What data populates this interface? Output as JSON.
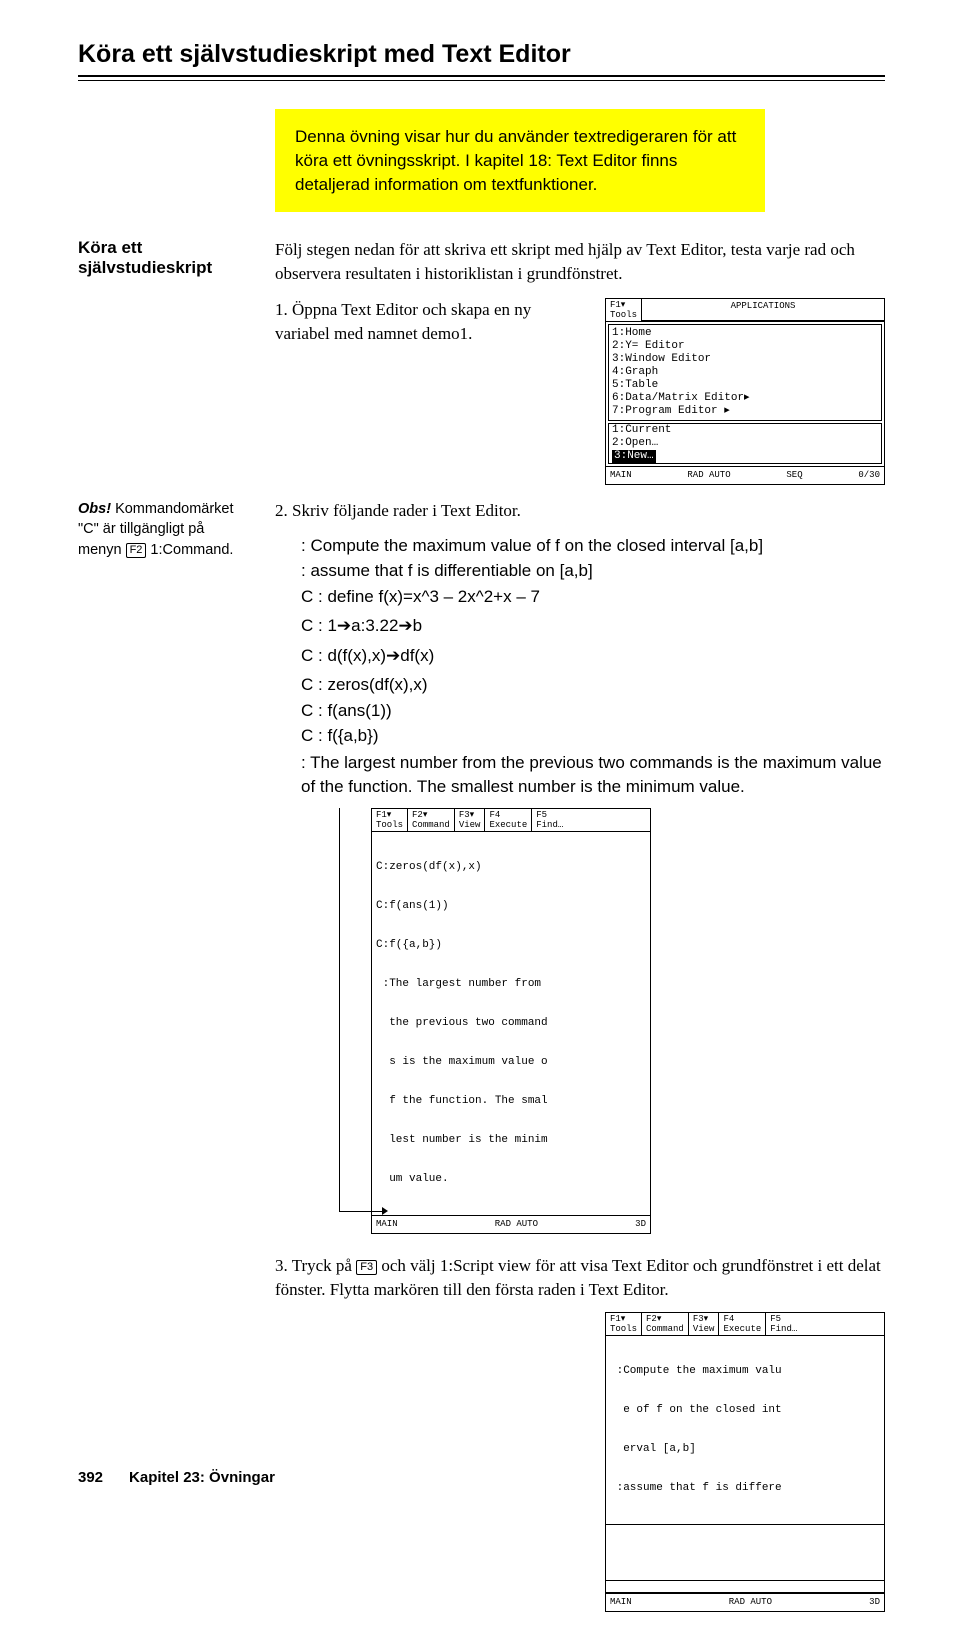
{
  "section_title": "Köra ett självstudieskript med Text Editor",
  "intro": "Denna övning visar hur du använder textredigeraren för att köra ett övningsskript. I kapitel 18: Text Editor finns detaljerad information om textfunktioner.",
  "col1": {
    "hd1": "Köra ett självstudieskript",
    "note_strong": "Obs! ",
    "note": "Kommandomärket \"C\" är tillgängligt på menyn ",
    "note_key": "F2",
    "note_tail": " 1:Command."
  },
  "body": {
    "p1": "Följ stegen nedan för att skriva ett skript med hjälp av Text Editor, testa varje rad och observera resultaten i historiklistan i grundfönstret.",
    "s1": "1. Öppna Text Editor och skapa en ny variabel med namnet demo1.",
    "s2": "2. Skriv följande rader i Text Editor.",
    "code": {
      "l1": ": Compute the maximum value of f on the closed interval [a,b]",
      "l2": ": assume that f is differentiable on [a,b]",
      "l3": "C : define f(x)=x^3 – 2x^2+x – 7",
      "l4a": "C : 1",
      "l4b": "a:3.22",
      "l4c": "b",
      "l5a": "C : d(f(x),x)",
      "l5b": "df(x)",
      "l6": "C : zeros(df(x),x)",
      "l7": "C : f(ans(1))",
      "l8": "C : f({a,b})"
    },
    "note2": ": The largest number from the previous two commands is the maximum value of the function. The smallest number is the minimum value.",
    "s3a": "3. Tryck på ",
    "s3_key": "F3",
    "s3b": " och välj 1:Script view för att visa Text Editor och grundfönstret i ett delat fönster. Flytta markören till den första raden i Text Editor."
  },
  "screen1": {
    "tab1": "F1▾\nTools",
    "appsTitle": "APPLICATIONS",
    "items": [
      "1:Home",
      "2:Y= Editor",
      "3:Window Editor",
      "4:Graph",
      "5:Table",
      "6:Data/Matrix Editor▸",
      "7:Program Editor   ▸"
    ],
    "sub": [
      "1:Current",
      "2:Open…"
    ],
    "sub_sel": "3:New…",
    "status": {
      "l": "MAIN",
      "m": "RAD AUTO",
      "r": "SEQ",
      "x": "0/30"
    }
  },
  "screen2": {
    "tabs": [
      "F1▾\nTools",
      "F2▾\nCommand",
      "F3▾\nView",
      "F4\nExecute",
      "F5\nFind…"
    ],
    "lines": [
      "C:zeros(df(x),x)",
      "C:f(ans(1))",
      "C:f({a,b})",
      " :The largest number from",
      "  the previous two command",
      "  s is the maximum value o",
      "  f the function. The smal",
      "  lest number is the minim",
      "  um value."
    ],
    "status": {
      "l": "MAIN",
      "m": "RAD AUTO",
      "r": "3D"
    }
  },
  "screen3": {
    "tabs": [
      "F1▾\nTools",
      "F2▾\nCommand",
      "F3▾\nView",
      "F4\nExecute",
      "F5\nFind…"
    ],
    "lines": [
      " :Compute the maximum valu",
      "  e of f on the closed int",
      "  erval [a,b]",
      " :assume that f is differe"
    ],
    "status": {
      "l": "MAIN",
      "m": "RAD AUTO",
      "r": "3D"
    }
  },
  "footer": {
    "pg": "392",
    "ch": "Kapitel 23: Övningar"
  },
  "arrow": "➔"
}
